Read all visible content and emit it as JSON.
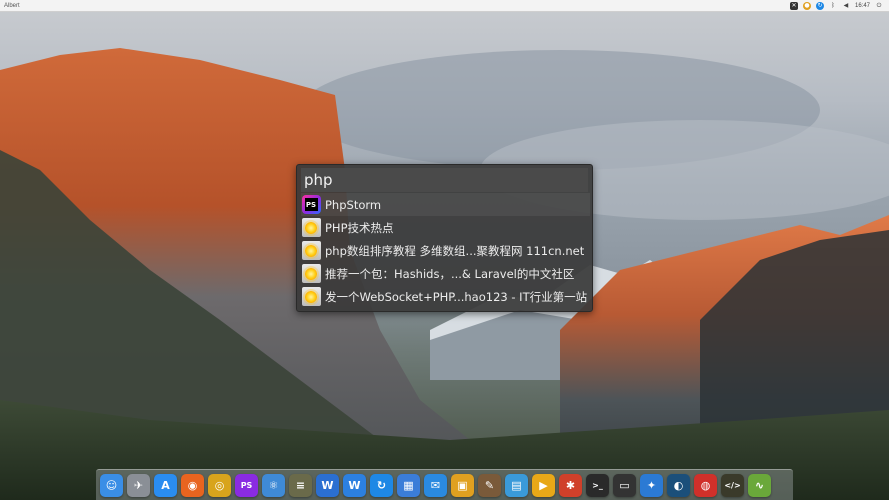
{
  "top_panel": {
    "app_name": "Albert",
    "clock": "16:47",
    "tray_icons": [
      "close-icon",
      "chrome-icon",
      "sync-icon",
      "bluetooth-icon",
      "volume-icon",
      "power-icon"
    ]
  },
  "launcher": {
    "query": "php",
    "results": [
      {
        "label": "PhpStorm",
        "icon": "phpstorm-icon"
      },
      {
        "label": "PHP技术热点",
        "icon": "web-search-icon"
      },
      {
        "label": "php数组排序教程 多维数组...聚教程网 111cn.net",
        "icon": "web-search-icon"
      },
      {
        "label": "推荐一个包：Hashids，...& Laravel的中文社区",
        "icon": "web-search-icon"
      },
      {
        "label": "发一个WebSocket+PHP...hao123 - IT行业第一站",
        "icon": "web-search-icon"
      }
    ]
  },
  "dock": {
    "items": [
      {
        "name": "finder-icon",
        "glyph": "☺",
        "color": "#3a8ee6"
      },
      {
        "name": "launchpad-icon",
        "glyph": "✈",
        "color": "#8a8f96"
      },
      {
        "name": "app-store-icon",
        "glyph": "A",
        "color": "#2a8df0"
      },
      {
        "name": "firefox-icon",
        "glyph": "◉",
        "color": "#e8641f"
      },
      {
        "name": "chrome-icon",
        "glyph": "◎",
        "color": "#d8a41c"
      },
      {
        "name": "phpstorm-icon",
        "glyph": "PS",
        "color": "#8a2be2"
      },
      {
        "name": "atom-icon",
        "glyph": "⚛",
        "color": "#3f8ad6"
      },
      {
        "name": "notes-icon",
        "glyph": "≡",
        "color": "#6a6a4a"
      },
      {
        "name": "wps-writer-icon",
        "glyph": "W",
        "color": "#2b6fd1"
      },
      {
        "name": "word-icon",
        "glyph": "W",
        "color": "#2c80e0"
      },
      {
        "name": "sync-icon",
        "glyph": "↻",
        "color": "#1e88e5"
      },
      {
        "name": "apps-grid-icon",
        "glyph": "▦",
        "color": "#3b7dd8"
      },
      {
        "name": "mail-icon",
        "glyph": "✉",
        "color": "#2a8ae0"
      },
      {
        "name": "files-icon",
        "glyph": "▣",
        "color": "#e0a020"
      },
      {
        "name": "feather-icon",
        "glyph": "✎",
        "color": "#7a5a3a"
      },
      {
        "name": "image-viewer-icon",
        "glyph": "▤",
        "color": "#3a9ad9"
      },
      {
        "name": "video-icon",
        "glyph": "▶",
        "color": "#e8a818"
      },
      {
        "name": "calendar-icon",
        "glyph": "✱",
        "color": "#d0402a"
      },
      {
        "name": "terminal-icon",
        "glyph": ">_",
        "color": "#2a2a2a"
      },
      {
        "name": "monitor-icon",
        "glyph": "▭",
        "color": "#333333"
      },
      {
        "name": "safari-icon",
        "glyph": "✦",
        "color": "#2b7ad4"
      },
      {
        "name": "steam-icon",
        "glyph": "◐",
        "color": "#1b4f7a"
      },
      {
        "name": "netease-music-icon",
        "glyph": "◍",
        "color": "#d0302a"
      },
      {
        "name": "code-editor-icon",
        "glyph": "</>",
        "color": "#3a3a2a"
      },
      {
        "name": "activity-monitor-icon",
        "glyph": "∿",
        "color": "#6aa83a"
      }
    ]
  }
}
